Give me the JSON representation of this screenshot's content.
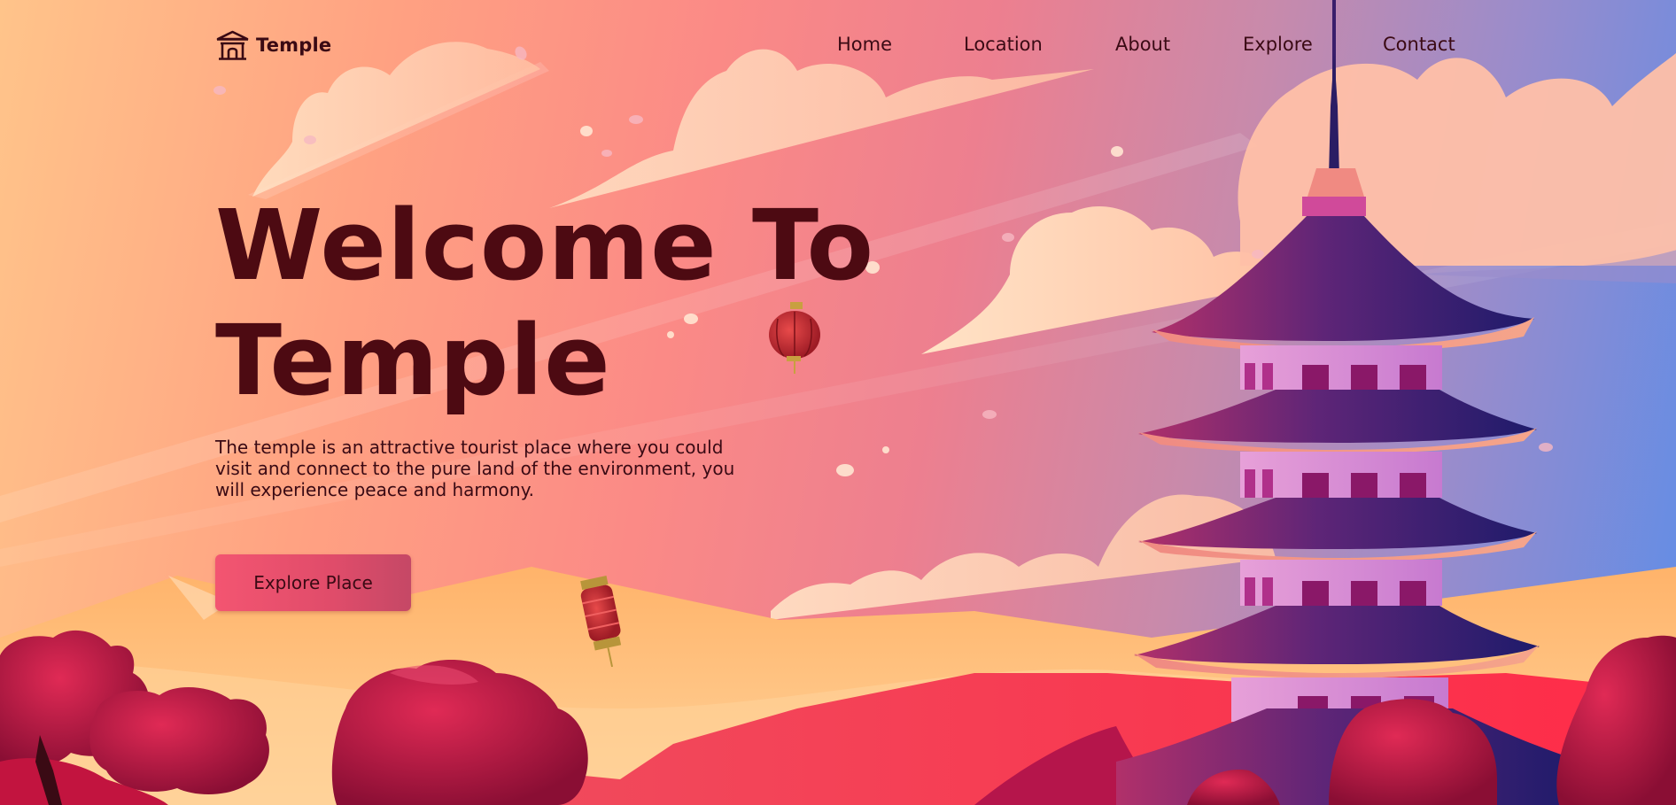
{
  "brand": {
    "name": "Temple",
    "icon": "temple-icon"
  },
  "nav": {
    "items": [
      {
        "label": "Home"
      },
      {
        "label": "Location"
      },
      {
        "label": "About"
      },
      {
        "label": "Explore"
      },
      {
        "label": "Contact"
      }
    ]
  },
  "hero": {
    "title_line1": "Welcome To",
    "title_line2": "Temple",
    "description": "The temple is an attractive tourist place where you could visit and connect to the pure land of the environment, you will experience peace and harmony.",
    "cta_label": "Explore Place"
  },
  "colors": {
    "text_dark": "#4d0a12",
    "cta": "#f35571",
    "sky_left": "#ffc48a",
    "sky_right": "#5e8de8"
  }
}
